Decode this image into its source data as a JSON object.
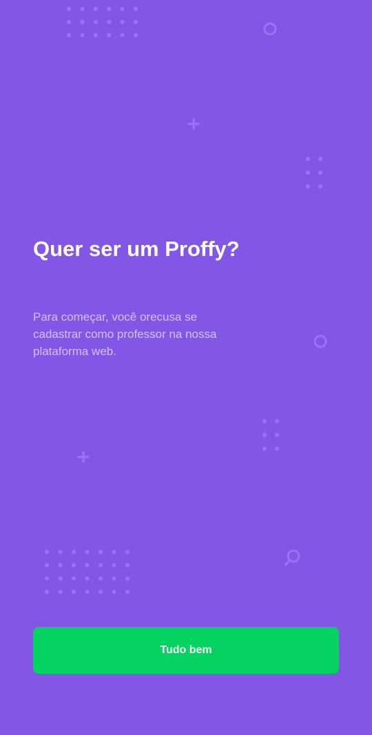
{
  "onboarding": {
    "title": "Quer ser um Proffy?",
    "description": "Para começar, você orecusa se cadastrar como professor na nossa plataforma web.",
    "button_label": "Tudo bem"
  },
  "colors": {
    "background": "#8257e5",
    "decoration": "#9871f5",
    "button": "#04d361",
    "title": "#ffffff",
    "description": "#d4c2ff"
  },
  "decorations": [
    "dot-grid",
    "circle-outline",
    "plus-sign",
    "search-icon"
  ]
}
